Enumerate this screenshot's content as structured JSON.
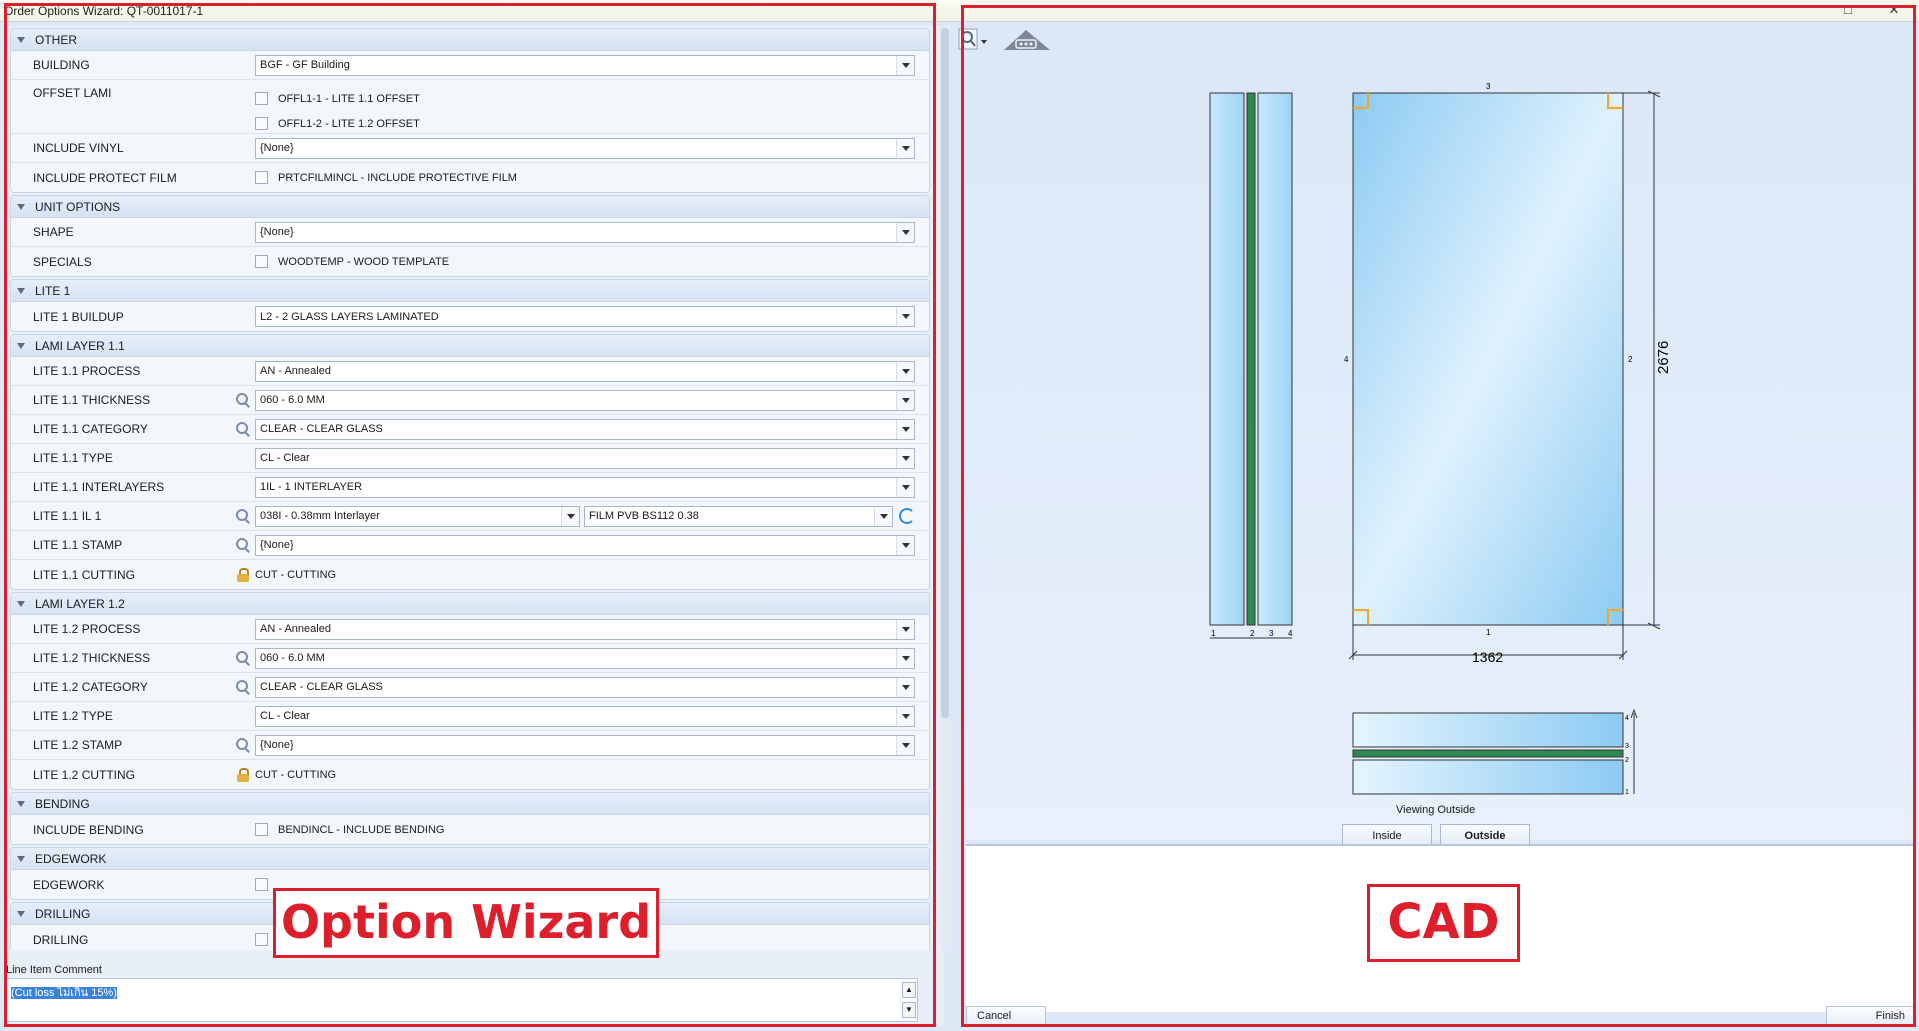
{
  "window": {
    "title": "Order Options Wizard: QT-0011017-1"
  },
  "wizard": {
    "sections": [
      {
        "title": "OTHER",
        "rows": [
          {
            "label": "BUILDING",
            "type": "combo",
            "value": "BGF - GF Building"
          },
          {
            "label": "OFFSET LAMI",
            "type": "checks",
            "options": [
              "OFFL1-1 - LITE 1.1 OFFSET",
              "OFFL1-2 - LITE 1.2 OFFSET"
            ]
          },
          {
            "label": "INCLUDE VINYL",
            "type": "combo",
            "value": "{None}"
          },
          {
            "label": "INCLUDE PROTECT FILM",
            "type": "check",
            "option": "PRTCFILMINCL - INCLUDE PROTECTIVE FILM"
          }
        ]
      },
      {
        "title": "UNIT OPTIONS",
        "rows": [
          {
            "label": "SHAPE",
            "type": "combo",
            "value": "{None}"
          },
          {
            "label": "SPECIALS",
            "type": "check",
            "option": "WOODTEMP - WOOD TEMPLATE"
          }
        ]
      },
      {
        "title": "LITE 1",
        "rows": [
          {
            "label": "LITE 1 BUILDUP",
            "type": "combo",
            "value": "L2 - 2 GLASS LAYERS LAMINATED"
          }
        ]
      },
      {
        "title": "LAMI LAYER 1.1",
        "rows": [
          {
            "label": "LITE 1.1 PROCESS",
            "type": "combo",
            "value": "AN - Annealed"
          },
          {
            "label": "LITE 1.1 THICKNESS",
            "type": "combo",
            "icon": "search",
            "value": "060 - 6.0 MM"
          },
          {
            "label": "LITE 1.1 CATEGORY",
            "type": "combo",
            "icon": "search",
            "value": "CLEAR - CLEAR GLASS"
          },
          {
            "label": "LITE 1.1 TYPE",
            "type": "combo",
            "value": "CL - Clear"
          },
          {
            "label": "LITE 1.1 INTERLAYERS",
            "type": "combo",
            "value": "1IL - 1 INTERLAYER"
          },
          {
            "label": "LITE 1.1 IL 1",
            "type": "dual",
            "icon": "search",
            "value": "038I - 0.38mm Interlayer",
            "value2": "FILM PVB BS112 0.38"
          },
          {
            "label": "LITE 1.1 STAMP",
            "type": "combo",
            "icon": "search",
            "value": "{None}"
          },
          {
            "label": "LITE 1.1 CUTTING",
            "type": "locked",
            "icon": "lock",
            "value": "CUT - CUTTING"
          }
        ]
      },
      {
        "title": "LAMI LAYER 1.2",
        "rows": [
          {
            "label": "LITE 1.2 PROCESS",
            "type": "combo",
            "value": "AN - Annealed"
          },
          {
            "label": "LITE 1.2 THICKNESS",
            "type": "combo",
            "icon": "search",
            "value": "060 - 6.0 MM"
          },
          {
            "label": "LITE 1.2 CATEGORY",
            "type": "combo",
            "icon": "search",
            "value": "CLEAR - CLEAR GLASS"
          },
          {
            "label": "LITE 1.2 TYPE",
            "type": "combo",
            "value": "CL - Clear"
          },
          {
            "label": "LITE 1.2 STAMP",
            "type": "combo",
            "icon": "search",
            "value": "{None}"
          },
          {
            "label": "LITE 1.2 CUTTING",
            "type": "locked",
            "icon": "lock",
            "value": "CUT - CUTTING"
          }
        ]
      },
      {
        "title": "BENDING",
        "rows": [
          {
            "label": "INCLUDE BENDING",
            "type": "check",
            "option": "BENDINCL - INCLUDE BENDING"
          }
        ]
      },
      {
        "title": "EDGEWORK",
        "rows": [
          {
            "label": "EDGEWORK",
            "type": "check",
            "option": ""
          }
        ]
      },
      {
        "title": "DRILLING",
        "rows": [
          {
            "label": "DRILLING",
            "type": "check",
            "option": ""
          }
        ]
      }
    ],
    "comment_label": "Line Item Comment",
    "comment_value": "(Cut loss ไม่เกิน 15%)"
  },
  "cad": {
    "side_labels": [
      "1",
      "2",
      "3",
      "4"
    ],
    "edge_labels": {
      "top": "3",
      "bottom": "1",
      "left": "4",
      "right": "2"
    },
    "width_dim": "1362",
    "height_dim": "2676",
    "section_labels": [
      "4",
      "3",
      "2",
      "1"
    ],
    "viewing_label": "Viewing Outside",
    "inside_button": "Inside",
    "outside_button": "Outside"
  },
  "footer": {
    "cancel": "Cancel",
    "finish": "Finish"
  },
  "annotations": {
    "left_label": "Option Wizard",
    "right_label": "CAD"
  },
  "colors": {
    "annotation": "#dd1f2c",
    "glass_light": "#dff2fd",
    "glass_dark": "#8ccaf2",
    "interlayer": "#2f8a52",
    "corner": "#f0a830"
  }
}
